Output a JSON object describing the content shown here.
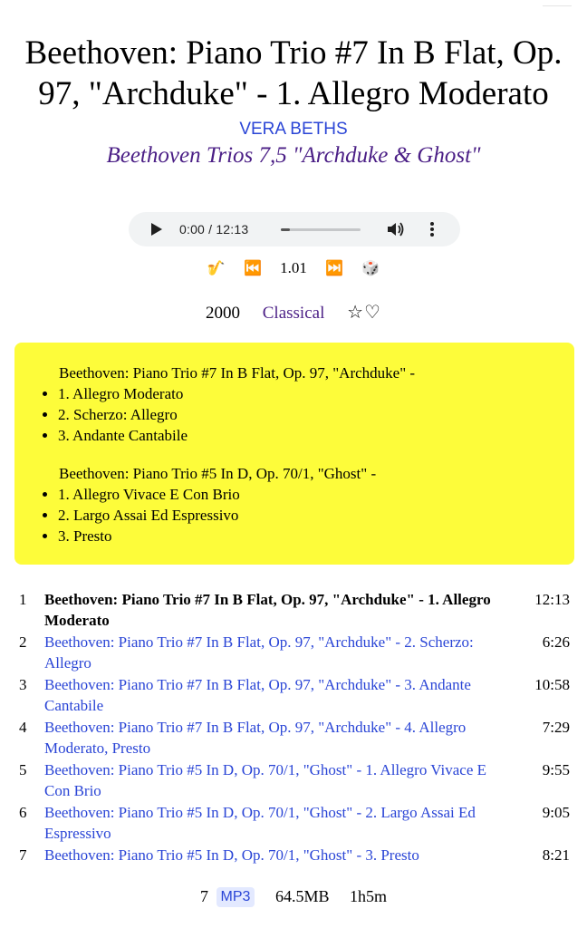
{
  "track": {
    "title": "Beethoven: Piano Trio #7 In B Flat, Op. 97, \"Archduke\" - 1. Allegro Moderato",
    "artist": "VERA BETHS",
    "album": "Beethoven Trios 7,5 \"Archduke & Ghost\""
  },
  "player": {
    "time": "0:00 / 12:13",
    "progress": 0.0
  },
  "controls": {
    "instrument_icon": "🎷",
    "prev_icon": "⏮️",
    "speed": "1.01",
    "next_icon": "⏭️",
    "shuffle_icon": "🎲"
  },
  "meta": {
    "year": "2000",
    "genre": "Classical",
    "star_icon": "☆",
    "heart_icon": "♡"
  },
  "notes": {
    "groups": [
      {
        "heading": "Beethoven: Piano Trio #7 In B Flat, Op. 97, \"Archduke\" -",
        "items": [
          "1. Allegro Moderato",
          "2. Scherzo: Allegro",
          "3. Andante Cantabile"
        ]
      },
      {
        "heading": "Beethoven: Piano Trio #5 In D, Op. 70/1, \"Ghost\" -",
        "items": [
          "1. Allegro Vivace E Con Brio",
          "2. Largo Assai Ed Espressivo",
          "3. Presto"
        ]
      }
    ]
  },
  "tracklist": [
    {
      "num": "1",
      "title": "Beethoven: Piano Trio #7 In B Flat, Op. 97, \"Archduke\" - 1. Allegro Moderato",
      "duration": "12:13"
    },
    {
      "num": "2",
      "title": "Beethoven: Piano Trio #7 In B Flat, Op. 97, \"Archduke\" - 2. Scherzo: Allegro",
      "duration": "6:26"
    },
    {
      "num": "3",
      "title": "Beethoven: Piano Trio #7 In B Flat, Op. 97, \"Archduke\" - 3. Andante Cantabile",
      "duration": "10:58"
    },
    {
      "num": "4",
      "title": "Beethoven: Piano Trio #7 In B Flat, Op. 97, \"Archduke\" - 4. Allegro Moderato, Presto",
      "duration": "7:29"
    },
    {
      "num": "5",
      "title": "Beethoven: Piano Trio #5 In D, Op. 70/1, \"Ghost\" - 1. Allegro Vivace E Con Brio",
      "duration": "9:55"
    },
    {
      "num": "6",
      "title": "Beethoven: Piano Trio #5 In D, Op. 70/1, \"Ghost\" - 2. Largo Assai Ed Espressivo",
      "duration": "9:05"
    },
    {
      "num": "7",
      "title": "Beethoven: Piano Trio #5 In D, Op. 70/1, \"Ghost\" - 3. Presto",
      "duration": "8:21"
    }
  ],
  "footer": {
    "count": "7",
    "format": "MP3",
    "size": "64.5MB",
    "total_duration": "1h5m"
  },
  "colors": {
    "link": "#2a45d6",
    "album": "#4b1f86",
    "notes_bg": "#fdfc3a",
    "player_bg": "#f1f3f4"
  }
}
